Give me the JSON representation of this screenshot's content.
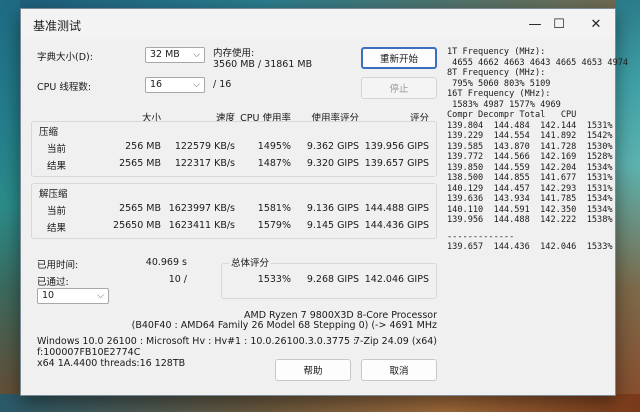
{
  "window": {
    "title": "基准测试",
    "minimize": "—",
    "maximize": "☐",
    "close": "✕"
  },
  "dict": {
    "label": "字典大小(D):",
    "value": "32 MB"
  },
  "threads": {
    "label": "CPU 线程数:",
    "value": "16",
    "total": "/ 16"
  },
  "memory": {
    "label": "内存使用:",
    "value": "3560 MB / 31861 MB"
  },
  "buttons": {
    "restart": "重新开始",
    "stop": "停止",
    "help": "帮助",
    "cancel": "取消"
  },
  "headers": {
    "size": "大小",
    "speed": "速度",
    "cpu": "CPU 使用率",
    "rating_per_usage": "使用率评分",
    "rating": "评分"
  },
  "compress": {
    "title": "压缩",
    "rows": [
      {
        "label": "当前",
        "size": "256 MB",
        "speed": "122579 KB/s",
        "cpu": "1495%",
        "rpu": "9.362 GIPS",
        "rating": "139.956 GIPS"
      },
      {
        "label": "结果",
        "size": "2565 MB",
        "speed": "122317 KB/s",
        "cpu": "1487%",
        "rpu": "9.320 GIPS",
        "rating": "139.657 GIPS"
      }
    ]
  },
  "decompress": {
    "title": "解压缩",
    "rows": [
      {
        "label": "当前",
        "size": "2565 MB",
        "speed": "1623997 KB/s",
        "cpu": "1581%",
        "rpu": "9.136 GIPS",
        "rating": "144.488 GIPS"
      },
      {
        "label": "结果",
        "size": "25650 MB",
        "speed": "1623411 KB/s",
        "cpu": "1579%",
        "rpu": "9.145 GIPS",
        "rating": "144.436 GIPS"
      }
    ]
  },
  "elapsed": {
    "label": "已用时间:",
    "value": "40.969 s"
  },
  "passes": {
    "label": "已通过:",
    "value": "10 /"
  },
  "passes_select": {
    "value": "10"
  },
  "total": {
    "title": "总体评分",
    "cpu": "1533%",
    "rpu": "9.268 GIPS",
    "rating": "142.046 GIPS"
  },
  "cpu_info": {
    "line1": "AMD Ryzen 7 9800X3D 8-Core Processor",
    "line2": "(B40F40 : AMD64 Family 26 Model 68 Stepping 0) (-> 4691 MHz"
  },
  "sys_info": {
    "line1": "Windows 10.0 26100 : Microsoft Hv : Hv#1 : 10.0.26100.3.0.3775 :",
    "line2": "f:100007FB10E2774C",
    "line3": "x64 1A.4400 threads:16 128TB"
  },
  "version": "7-Zip 24.09 (x64)",
  "right_panel": [
    "1T Frequency (MHz):",
    " 4655 4662 4663 4643 4665 4653 4974",
    "8T Frequency (MHz):",
    " 795% 5060 803% 5109",
    "16T Frequency (MHz):",
    " 1583% 4987 1577% 4969",
    "Compr Decompr Total   CPU",
    "139.804  144.484  142.144  1531%",
    "139.229  144.554  141.892  1542%",
    "139.585  143.870  141.728  1530%",
    "139.772  144.566  142.169  1528%",
    "139.850  144.559  142.204  1534%",
    "138.500  144.855  141.677  1531%",
    "140.129  144.457  142.293  1531%",
    "139.636  143.934  141.785  1534%",
    "140.110  144.591  142.350  1534%",
    "139.956  144.488  142.222  1538%",
    "-------------",
    "139.657  144.436  142.046  1533%"
  ]
}
